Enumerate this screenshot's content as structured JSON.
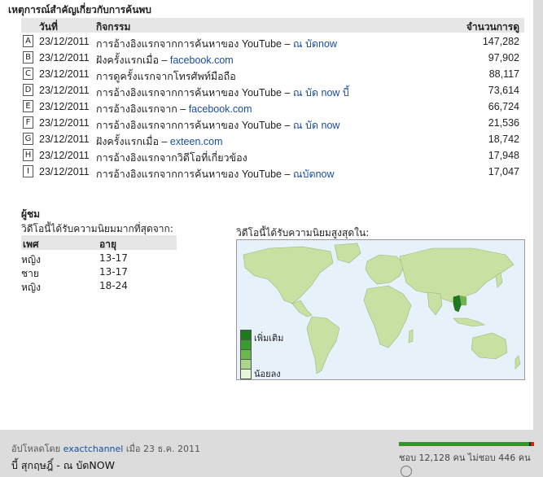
{
  "events": {
    "title": "เหตุการณ์สำคัญเกี่ยวกับการค้นพบ",
    "headers": {
      "date": "วันที่",
      "activity": "กิจกรรม",
      "views": "จำนวนการดู"
    },
    "rows": [
      {
        "letter": "A",
        "date": "23/12/2011",
        "text": "การอ้างอิงแรกจากการค้นหาของ YouTube – ",
        "link": "ณ บัดnow",
        "count": "147,282"
      },
      {
        "letter": "B",
        "date": "23/12/2011",
        "text": "ฝังครั้งแรกเมื่อ – ",
        "link": "facebook.com",
        "count": "97,902"
      },
      {
        "letter": "C",
        "date": "23/12/2011",
        "text": "การดูครั้งแรกจากโทรศัพท์มือถือ",
        "link": "",
        "count": "88,117"
      },
      {
        "letter": "D",
        "date": "23/12/2011",
        "text": "การอ้างอิงแรกจากการค้นหาของ YouTube – ",
        "link": "ณ บัด now บี้",
        "count": "73,614"
      },
      {
        "letter": "E",
        "date": "23/12/2011",
        "text": "การอ้างอิงแรกจาก – ",
        "link": "facebook.com",
        "count": "66,724"
      },
      {
        "letter": "F",
        "date": "23/12/2011",
        "text": "การอ้างอิงแรกจากการค้นหาของ YouTube – ",
        "link": "ณ บัด now",
        "count": "21,536"
      },
      {
        "letter": "G",
        "date": "23/12/2011",
        "text": "ฝังครั้งแรกเมื่อ – ",
        "link": "exteen.com",
        "count": "18,742"
      },
      {
        "letter": "H",
        "date": "23/12/2011",
        "text": "การอ้างอิงแรกจากวิดีโอที่เกี่ยวข้อง",
        "link": "",
        "count": "17,948"
      },
      {
        "letter": "I",
        "date": "23/12/2011",
        "text": "การอ้างอิงแรกจากการค้นหาของ YouTube – ",
        "link": "ณบัดnow",
        "count": "17,047"
      }
    ]
  },
  "viewers": {
    "title": "ผู้ชม",
    "popular_from": "วิดีโอนี้ได้รับความนิยมมากที่สุดจาก:",
    "headers": {
      "gender": "เพศ",
      "age": "อายุ"
    },
    "rows": [
      {
        "gender": "หญิง",
        "age": "13-17"
      },
      {
        "gender": "ชาย",
        "age": "13-17"
      },
      {
        "gender": "หญิง",
        "age": "18-24"
      }
    ]
  },
  "map": {
    "label": "วิดีโอนี้ได้รับความนิยมสูงสุดใน:",
    "legend_more": "เพิ่มเติม",
    "legend_less": "น้อยลง",
    "legend_colors": [
      "#1e7a1e",
      "#3a9a2e",
      "#6bb64e",
      "#a8d68a",
      "#e6f4d8"
    ],
    "ocean_color": "#e6f1fa",
    "land_color": "#c9e0a3",
    "highlight_color": "#1e7a1e"
  },
  "footer": {
    "uploaded_by_prefix": "อัปโหลดโดย ",
    "uploader": "exactchannel",
    "uploaded_on": " เมื่อ 23 ธ.ค. 2011",
    "video_title": "บี้ สุกฤษฎิ์ - ณ บัดNOW",
    "likes_text": "ชอบ 12,128 คน ไม่ชอบ 446 คน",
    "like_ratio": 0.965
  }
}
